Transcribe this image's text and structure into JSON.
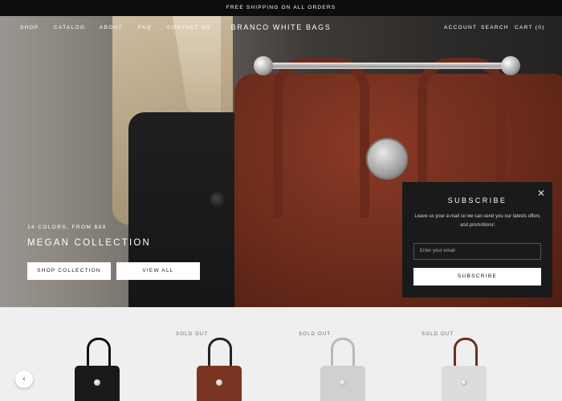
{
  "announcement": "FREE SHIPPING ON ALL ORDERS",
  "nav": {
    "left": [
      "SHOP",
      "CATALOG",
      "ABOUT",
      "FAQ",
      "CONTACT US"
    ],
    "logo": "BRANCO WHITE BAGS",
    "right": [
      "ACCOUNT",
      "SEARCH",
      "CART (0)"
    ]
  },
  "hero": {
    "subtitle": "14 COLORS, FROM $89",
    "title": "MEGAN COLLECTION",
    "primary_button": "SHOP COLLECTION",
    "secondary_button": "VIEW ALL"
  },
  "popup": {
    "close_icon": "close-icon",
    "title": "SUBSCRIBE",
    "text": "Leave us your e-mail so we can send you our latests offers and promotions!",
    "email_placeholder": "Enter your email",
    "button": "SUBSCRIBE"
  },
  "products": [
    {
      "badge": "",
      "color": "#1a1a1a",
      "handle": "#111111"
    },
    {
      "badge": "SOLD OUT",
      "color": "#7a3422",
      "handle": "#222222"
    },
    {
      "badge": "SOLD OUT",
      "color": "#cfd0d2",
      "handle": "#b8b9bb"
    },
    {
      "badge": "SOLD OUT",
      "color": "#dcdcdc",
      "handle": "#6e2f1f"
    }
  ],
  "carousel": {
    "prev_icon": "chevron-left-icon"
  }
}
